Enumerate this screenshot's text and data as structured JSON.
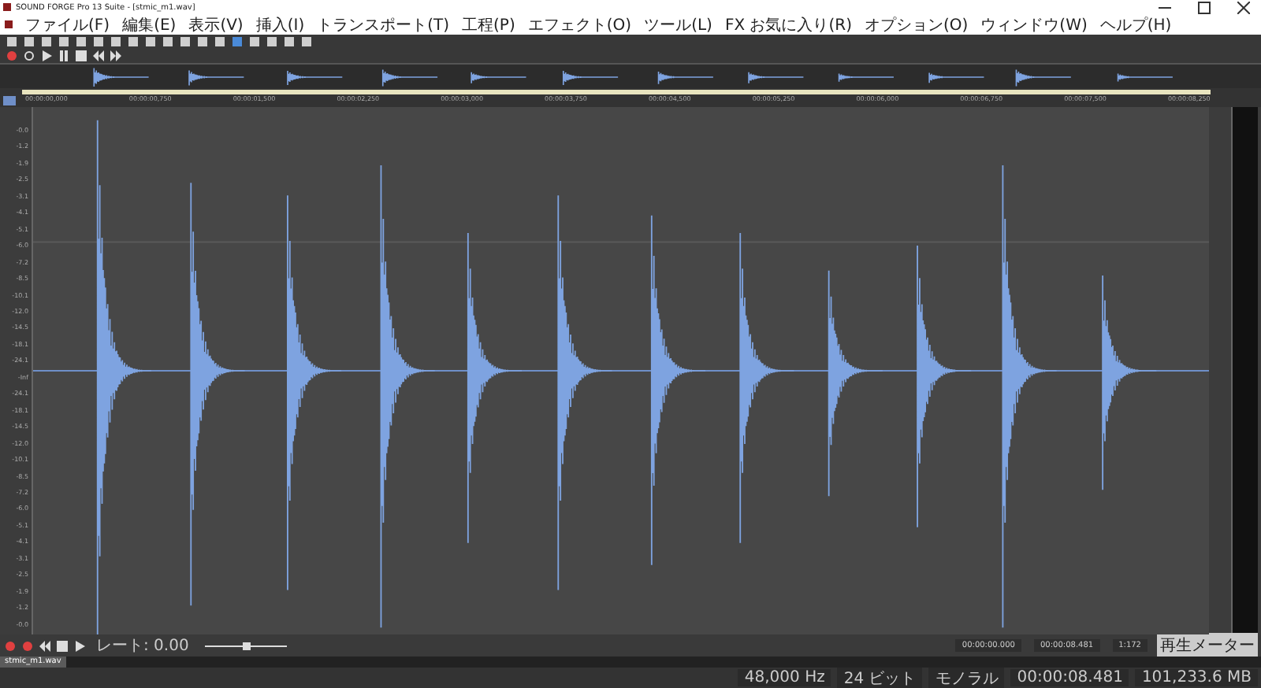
{
  "window": {
    "title": "SOUND FORGE Pro 13 Suite - [stmic_m1.wav]"
  },
  "menu": [
    "ファイル(F)",
    "編集(E)",
    "表示(V)",
    "挿入(I)",
    "トランスポート(T)",
    "工程(P)",
    "エフェクト(O)",
    "ツール(L)",
    "FX お気に入り(R)",
    "オプション(O)",
    "ウィンドウ(W)",
    "ヘルプ(H)"
  ],
  "ruler_labels": [
    "00:00:00,000",
    "00:00:00,750",
    "00:00:01,500",
    "00:00:02,250",
    "00:00:03,000",
    "00:00:03,750",
    "00:00:04,500",
    "00:00:05,250",
    "00:00:06,000",
    "00:00:06,750",
    "00:00:07,500",
    "00:00:08,250"
  ],
  "db_labels": [
    "-0.0",
    "-1.2",
    "-1.9",
    "-2.5",
    "-3.1",
    "-4.1",
    "-5.1",
    "-6.0",
    "-7.2",
    "-8.5",
    "-10.1",
    "-12.0",
    "-14.5",
    "-18.1",
    "-24.1",
    "-Inf",
    "-24.1",
    "-18.1",
    "-14.5",
    "-12.0",
    "-10.1",
    "-8.5",
    "-7.2",
    "-6.0",
    "-5.1",
    "-4.1",
    "-3.1",
    "-2.5",
    "-1.9",
    "-1.2",
    "-0.0"
  ],
  "transport": {
    "rate": "レート: 0.00",
    "zoom": {
      "level": 0.5
    }
  },
  "time_fields": [
    "00:00:00.000",
    "00:00:08.481",
    "1:172"
  ],
  "meter_button": "再生メーター",
  "tab": {
    "label": "stmic_m1.wav",
    "selected": true
  },
  "status": [
    "48,000 Hz",
    "24 ビット",
    "モノラル",
    "00:00:08.481",
    "101,233.6 MB"
  ]
}
